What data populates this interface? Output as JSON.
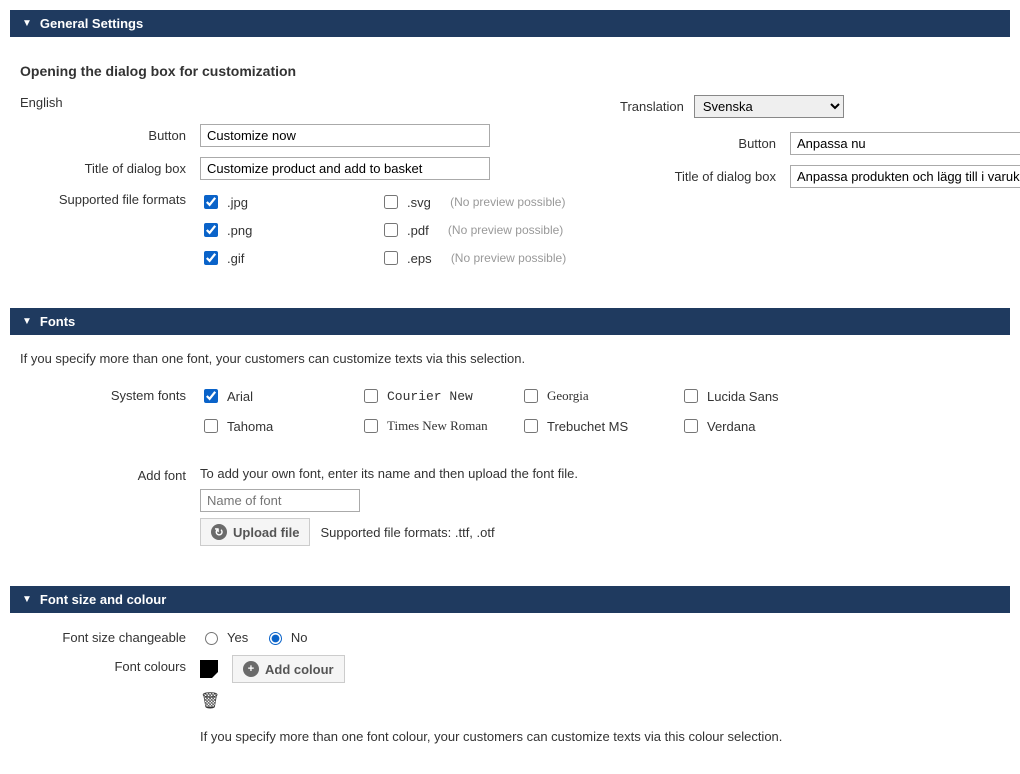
{
  "sections": {
    "general": {
      "title": "General Settings"
    },
    "fonts": {
      "title": "Fonts"
    },
    "fontsize": {
      "title": "Font size and colour"
    }
  },
  "general": {
    "heading": "Opening the dialog box for customization",
    "english_label": "English",
    "translation_label": "Translation",
    "translation_selected": "Svenska",
    "labels": {
      "button": "Button",
      "title_dialog": "Title of dialog box",
      "supported_formats": "Supported file formats"
    },
    "left": {
      "button_value": "Customize now",
      "title_value": "Customize product and add to basket"
    },
    "right": {
      "button_value": "Anpassa nu",
      "title_value": "Anpassa produkten och lägg till i varukorgen"
    },
    "formats": {
      "jpg": ".jpg",
      "png": ".png",
      "gif": ".gif",
      "svg": ".svg",
      "pdf": ".pdf",
      "eps": ".eps",
      "no_preview": "(No preview possible)"
    }
  },
  "fonts": {
    "help": "If you specify more than one font, your customers can customize texts via this selection.",
    "system_fonts_label": "System fonts",
    "items": {
      "arial": "Arial",
      "courier": "Courier New",
      "georgia": "Georgia",
      "lucida": "Lucida Sans",
      "tahoma": "Tahoma",
      "tnr": "Times New Roman",
      "trebuchet": "Trebuchet MS",
      "verdana": "Verdana"
    },
    "addfont_label": "Add font",
    "addfont_help": "To add your own font, enter its name and then upload the font file.",
    "addfont_placeholder": "Name of font",
    "upload_label": "Upload file",
    "upload_hint": "Supported file formats: .ttf, .otf"
  },
  "fontsize": {
    "changeable_label": "Font size changeable",
    "yes": "Yes",
    "no": "No",
    "colours_label": "Font colours",
    "add_colour_label": "Add colour",
    "help": "If you specify more than one font colour, your customers can customize texts via this colour selection."
  }
}
